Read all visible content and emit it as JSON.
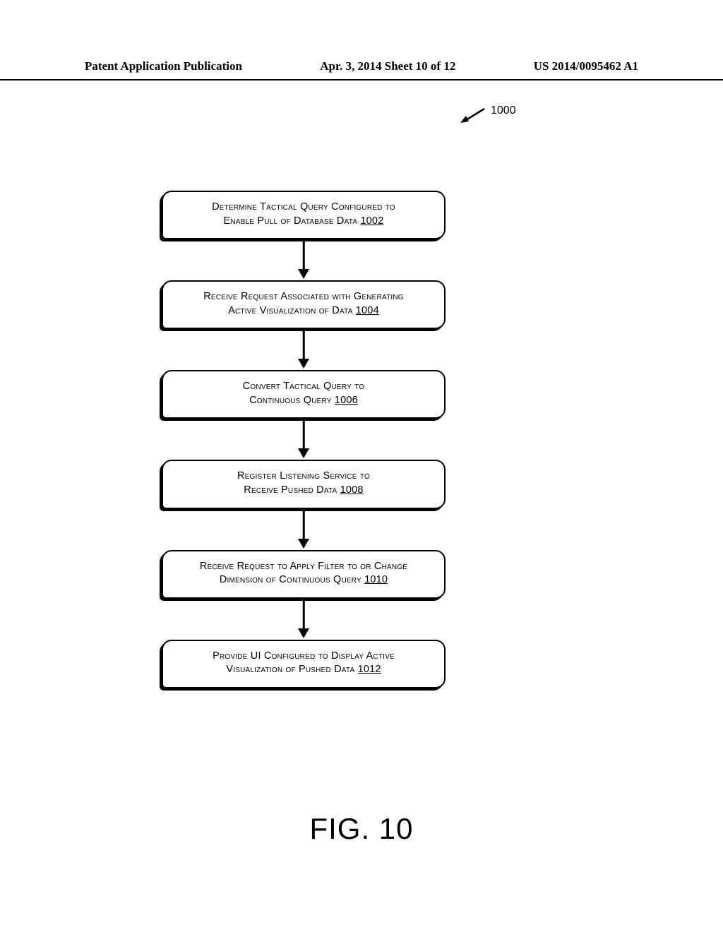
{
  "header": {
    "left": "Patent Application Publication",
    "center": "Apr. 3, 2014   Sheet 10 of 12",
    "right": "US 2014/0095462 A1"
  },
  "reference": {
    "label": "1000"
  },
  "steps": [
    {
      "text_line1": "Determine Tactical Query Configured to",
      "text_line2": "Enable Pull of Database Data ",
      "ref": "1002"
    },
    {
      "text_line1": "Receive Request Associated with Generating",
      "text_line2": "Active Visualization of Data ",
      "ref": "1004"
    },
    {
      "text_line1": "Convert Tactical Query to",
      "text_line2": "Continuous Query ",
      "ref": "1006"
    },
    {
      "text_line1": "Register Listening Service to",
      "text_line2": "Receive Pushed Data ",
      "ref": "1008"
    },
    {
      "text_line1": "Receive Request to Apply Filter to or Change",
      "text_line2": "Dimension of Continuous Query ",
      "ref": "1010"
    },
    {
      "text_line1": "Provide UI Configured to Display Active",
      "text_line2": "Visualization of Pushed Data ",
      "ref": "1012"
    }
  ],
  "figure_label": "FIG. 10"
}
